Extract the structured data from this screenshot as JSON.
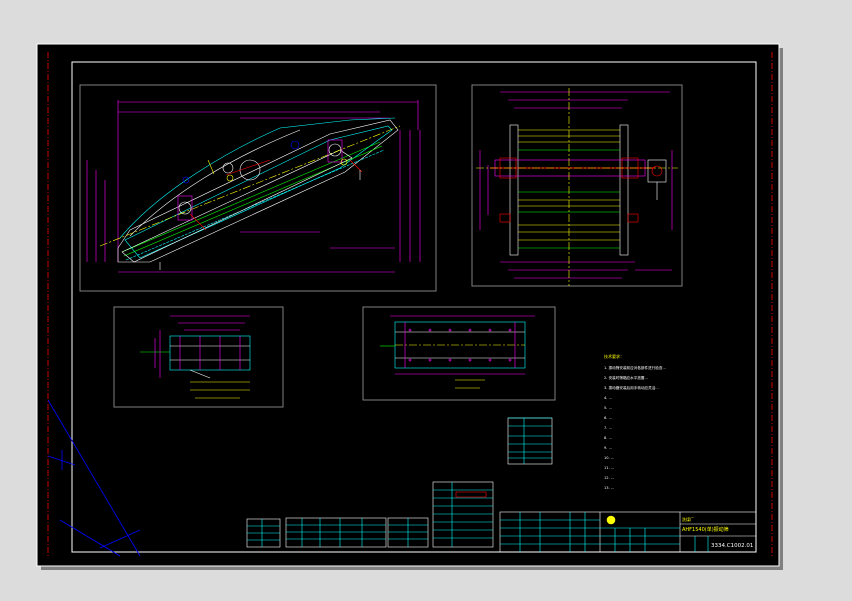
{
  "notes": {
    "title": "技术要求：",
    "lines": [
      "1. 振动筛安装前应对各部件进行检查...",
      "2. 安装时筛箱应水平放置...",
      "3. 振动器安装后用手转动应灵活...",
      "4. ...",
      "5. ...",
      "6. ...",
      "7. ...",
      "8. ...",
      "9. ...",
      "10. ...",
      "11. ...",
      "12. ...",
      "13. ..."
    ]
  },
  "title_block": {
    "company": "洗煤厂",
    "drawing_name": "AHF1540(单)振动筛",
    "drawing_number": "3334.C1002.01"
  },
  "colors": {
    "background": "#ffffff",
    "frame": "#000000",
    "viewport": "#808080",
    "cyan": "#00ffff",
    "magenta": "#ff00ff",
    "yellow": "#ffff00",
    "green": "#00ff00",
    "red": "#ff0000",
    "white": "#ffffff",
    "blue": "#0000ff"
  }
}
